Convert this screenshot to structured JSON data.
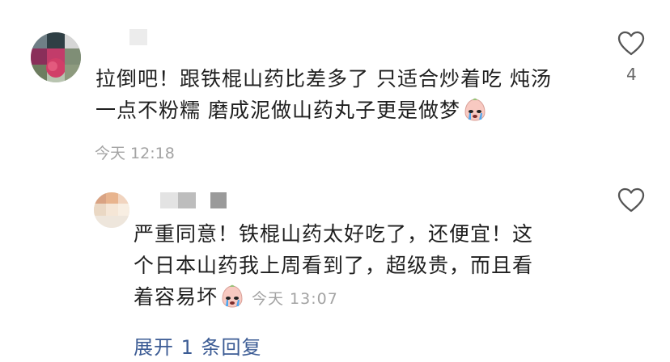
{
  "main_comment": {
    "text_line1": "拉倒吧！跟铁棍山药比差多了 只适合炒着吃 炖汤",
    "text_line2": "一点不粉糯 磨成泥做山药丸子更是做梦",
    "timestamp": "今天 12:18",
    "like_count": "4",
    "emoji": "crying-face-emoji"
  },
  "reply_comment": {
    "text_line1": "严重同意！铁棍山药太好吃了，还便宜！这",
    "text_line2": "个日本山药我上周看到了，超级贵，而且看",
    "text_line3": "着容易坏",
    "timestamp": "今天 13:07",
    "emoji": "crying-face-emoji"
  },
  "expand_replies": "展开 1 条回复",
  "icons": {
    "like": "heart-outline-icon"
  },
  "colors": {
    "link": "#3b5b94",
    "muted": "#a3a3a3",
    "text": "#1f1f1f"
  }
}
